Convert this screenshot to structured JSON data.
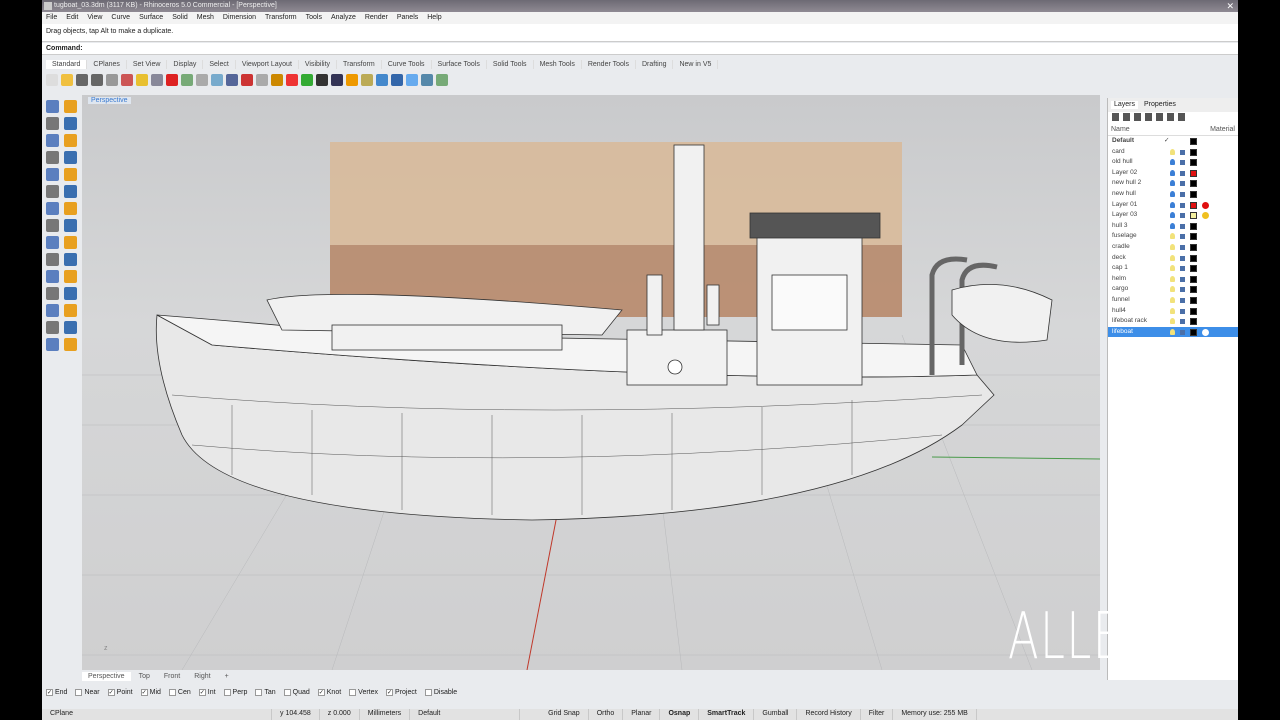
{
  "window": {
    "title": "tugboat_03.3dm (3117 KB) - Rhinoceros 5.0 Commercial - [Perspective]"
  },
  "menu": [
    "File",
    "Edit",
    "View",
    "Curve",
    "Surface",
    "Solid",
    "Mesh",
    "Dimension",
    "Transform",
    "Tools",
    "Analyze",
    "Render",
    "Panels",
    "Help"
  ],
  "command": {
    "history": "Drag objects, tap Alt to make a duplicate.",
    "label": "Command:",
    "value": ""
  },
  "toolbar_tabs": [
    "Standard",
    "CPlanes",
    "Set View",
    "Display",
    "Select",
    "Viewport Layout",
    "Visibility",
    "Transform",
    "Curve Tools",
    "Surface Tools",
    "Solid Tools",
    "Mesh Tools",
    "Render Tools",
    "Drafting",
    "New in V5"
  ],
  "viewport": {
    "label": "Perspective",
    "tabs": [
      "Perspective",
      "Top",
      "Front",
      "Right",
      "+"
    ]
  },
  "layers_panel": {
    "tabs": [
      "Layers",
      "Properties"
    ],
    "col_name": "Name",
    "col_material": "Material",
    "layers": [
      {
        "name": "Default",
        "bulb": "",
        "swatch": "#000000",
        "mat": "",
        "current": "✓"
      },
      {
        "name": "card",
        "bulb": "#f2e27a",
        "swatch": "#000000",
        "mat": ""
      },
      {
        "name": "old hull",
        "bulb": "#3b7fd6",
        "swatch": "#000000",
        "mat": ""
      },
      {
        "name": "Layer 02",
        "bulb": "#3b7fd6",
        "swatch": "#e01010",
        "mat": ""
      },
      {
        "name": "new hull 2",
        "bulb": "#3b7fd6",
        "swatch": "#000000",
        "mat": ""
      },
      {
        "name": "new hull",
        "bulb": "#3b7fd6",
        "swatch": "#000000",
        "mat": ""
      },
      {
        "name": "Layer 01",
        "bulb": "#3b7fd6",
        "swatch": "#e01010",
        "mat": "#e01010"
      },
      {
        "name": "Layer 03",
        "bulb": "#3b7fd6",
        "swatch": "#f4f0a0",
        "mat": "#f0c020"
      },
      {
        "name": "hull 3",
        "bulb": "#3b7fd6",
        "swatch": "#000000",
        "mat": ""
      },
      {
        "name": "fuselage",
        "bulb": "#f2e27a",
        "swatch": "#000000",
        "mat": ""
      },
      {
        "name": "cradle",
        "bulb": "#f2e27a",
        "swatch": "#000000",
        "mat": ""
      },
      {
        "name": "deck",
        "bulb": "#f2e27a",
        "swatch": "#000000",
        "mat": ""
      },
      {
        "name": "cap 1",
        "bulb": "#f2e27a",
        "swatch": "#000000",
        "mat": ""
      },
      {
        "name": "helm",
        "bulb": "#f2e27a",
        "swatch": "#000000",
        "mat": ""
      },
      {
        "name": "cargo",
        "bulb": "#f2e27a",
        "swatch": "#000000",
        "mat": ""
      },
      {
        "name": "funnel",
        "bulb": "#f2e27a",
        "swatch": "#000000",
        "mat": ""
      },
      {
        "name": "hull4",
        "bulb": "#f2e27a",
        "swatch": "#000000",
        "mat": ""
      },
      {
        "name": "lifeboat rack",
        "bulb": "#f2e27a",
        "swatch": "#000000",
        "mat": ""
      },
      {
        "name": "lifeboat",
        "bulb": "#f2e27a",
        "swatch": "#000000",
        "mat": "#ffffff",
        "selected": true
      }
    ]
  },
  "osnaps": [
    {
      "label": "End",
      "on": true
    },
    {
      "label": "Near",
      "on": false
    },
    {
      "label": "Point",
      "on": true
    },
    {
      "label": "Mid",
      "on": true
    },
    {
      "label": "Cen",
      "on": false
    },
    {
      "label": "Int",
      "on": true
    },
    {
      "label": "Perp",
      "on": false
    },
    {
      "label": "Tan",
      "on": false
    },
    {
      "label": "Quad",
      "on": false
    },
    {
      "label": "Knot",
      "on": true
    },
    {
      "label": "Vertex",
      "on": false
    },
    {
      "label": "Project",
      "on": true
    },
    {
      "label": "Disable",
      "on": false
    }
  ],
  "status": {
    "cplane": "CPlane",
    "y": "y 104.458",
    "z": "z 0.000",
    "units": "Millimeters",
    "layer": "Default",
    "toggles": [
      "Grid Snap",
      "Ortho",
      "Planar",
      "Osnap",
      "SmartTrack",
      "Gumball",
      "Record History",
      "Filter"
    ],
    "active": [
      "Osnap",
      "SmartTrack"
    ],
    "memory": "Memory use: 255 MB"
  },
  "watermark": "ALLE        M"
}
